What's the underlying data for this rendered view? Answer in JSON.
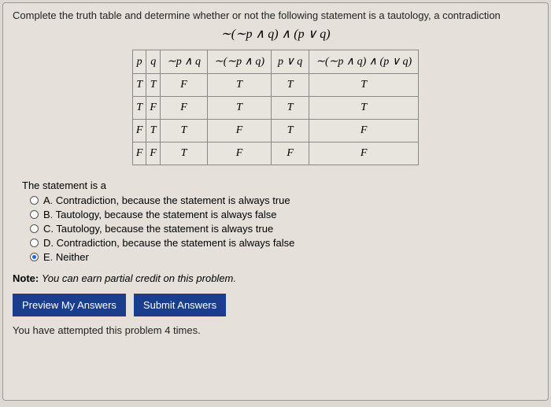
{
  "question": "Complete the truth table and determine whether or not the following statement is a tautology, a contradiction",
  "formula": "∼(∼p ∧ q) ∧ (p ∨ q)",
  "table": {
    "headers": [
      "p",
      "q",
      "∼p ∧ q",
      "∼(∼p ∧ q)",
      "p ∨ q",
      "∼(∼p ∧ q) ∧ (p ∨ q)"
    ],
    "rows": [
      [
        "T",
        "T",
        "F",
        "T",
        "T",
        "T"
      ],
      [
        "T",
        "F",
        "F",
        "T",
        "T",
        "T"
      ],
      [
        "F",
        "T",
        "T",
        "F",
        "T",
        "F"
      ],
      [
        "F",
        "F",
        "T",
        "F",
        "F",
        "F"
      ]
    ]
  },
  "answers": {
    "lead": "The statement is a",
    "choices": [
      "A. Contradiction, because the statement is always true",
      "B. Tautology, because the statement is always false",
      "C. Tautology, because the statement is always true",
      "D. Contradiction, because the statement is always false",
      "E. Neither"
    ],
    "selected": 4
  },
  "note_label": "Note:",
  "note_text": "You can earn partial credit on this problem.",
  "buttons": {
    "preview": "Preview My Answers",
    "submit": "Submit Answers"
  },
  "attempts": "You have attempted this problem 4 times."
}
